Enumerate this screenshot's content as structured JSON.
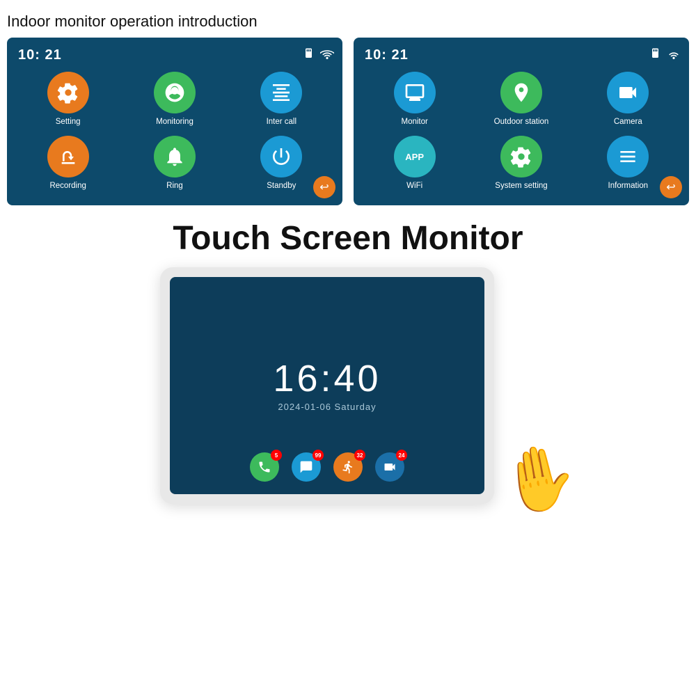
{
  "page": {
    "title": "Indoor monitor operation introduction"
  },
  "screen1": {
    "time": "10: 21",
    "items": [
      {
        "label": "Setting",
        "color": "orange",
        "icon": "gear"
      },
      {
        "label": "Monitoring",
        "color": "green",
        "icon": "camera"
      },
      {
        "label": "Inter call",
        "color": "blue",
        "icon": "intercall"
      },
      {
        "label": "Recording",
        "color": "orange",
        "icon": "recording"
      },
      {
        "label": "Ring",
        "color": "green",
        "icon": "bell"
      },
      {
        "label": "Standby",
        "color": "blue",
        "icon": "power"
      }
    ]
  },
  "screen2": {
    "time": "10: 21",
    "items": [
      {
        "label": "Monitor",
        "color": "blue",
        "icon": "monitor"
      },
      {
        "label": "Outdoor station",
        "color": "green",
        "icon": "outdoor"
      },
      {
        "label": "Camera",
        "color": "blue",
        "icon": "cctv"
      },
      {
        "label": "WiFi",
        "color": "teal",
        "icon": "wifi"
      },
      {
        "label": "System setting",
        "color": "green",
        "icon": "settings"
      },
      {
        "label": "Information",
        "color": "blue",
        "icon": "info"
      }
    ]
  },
  "touch_monitor": {
    "title": "Touch Screen Monitor",
    "time": "16:40",
    "date": "2024-01-06  Saturday",
    "icons": [
      {
        "icon": "phone",
        "color": "green",
        "badge": "5"
      },
      {
        "icon": "chat",
        "color": "blue",
        "badge": "99"
      },
      {
        "icon": "motion",
        "color": "orange",
        "badge": "32"
      },
      {
        "icon": "camera-rec",
        "color": "blue",
        "badge": "24"
      }
    ]
  }
}
